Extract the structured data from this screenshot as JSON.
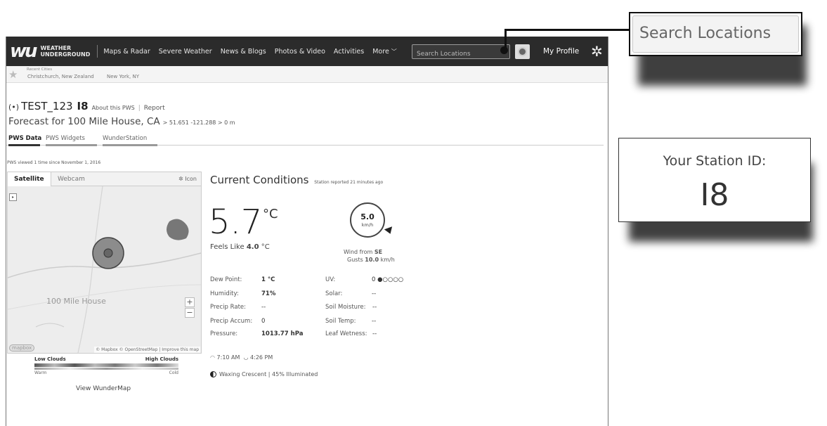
{
  "nav": {
    "logo_line1": "WEATHER",
    "logo_line2": "UNDERGROUND",
    "items": [
      "Maps & Radar",
      "Severe Weather",
      "News & Blogs",
      "Photos & Video",
      "Activities",
      "More"
    ],
    "search_placeholder": "Search Locations",
    "my_profile": "My Profile",
    "icons": [
      "wu-logo-icon",
      "chevron-down-icon",
      "locate-icon",
      "gear-icon"
    ]
  },
  "recent": {
    "label": "Recent Cities",
    "items": [
      "Christchurch, New Zealand",
      "New York, NY"
    ]
  },
  "station": {
    "name": "TEST_123",
    "id": "I8",
    "about": "About this PWS",
    "report": "Report",
    "forecast_title": "Forecast for 100 Mile House, CA",
    "forecast_coords": "> 51.651 -121.288 > 0 m"
  },
  "page_tabs": [
    "PWS Data",
    "PWS Widgets",
    "WunderStation"
  ],
  "pws_viewed": "PWS viewed 1 time since November 1, 2016",
  "map": {
    "tabs": [
      "Satellite",
      "Webcam"
    ],
    "icon_option": "Icon",
    "place_label": "100 Mile House",
    "attribution": "© Mapbox © OpenStreetMap | Improve this map",
    "mapbox": "mapbox",
    "zoom_in": "+",
    "zoom_out": "−",
    "legend_low": "Low Clouds",
    "legend_high": "High Clouds",
    "legend_warm": "Warm",
    "legend_cold": "Cold",
    "view_link": "View WunderMap"
  },
  "conditions": {
    "title": "Current Conditions",
    "reported": "Station reported 21 minutes ago",
    "temp": "5.7",
    "temp_unit": "°C",
    "feels_label": "Feels Like",
    "feels_value": "4.0",
    "feels_unit": "°C",
    "wind_speed": "5.0",
    "wind_unit": "km/h",
    "wind_from_label": "Wind from",
    "wind_from_value": "SE",
    "gusts_label": "Gusts",
    "gusts_value": "10.0",
    "gusts_unit": "km/h",
    "left_stats": [
      {
        "label": "Dew Point:",
        "value": "1 °C"
      },
      {
        "label": "Humidity:",
        "value": "71%"
      },
      {
        "label": "Precip Rate:",
        "value": "--"
      },
      {
        "label": "Precip Accum:",
        "value": "0"
      },
      {
        "label": "Pressure:",
        "value": "1013.77 hPa"
      }
    ],
    "right_stats": [
      {
        "label": "UV:",
        "value": "0 ●○○○○"
      },
      {
        "label": "Solar:",
        "value": "--"
      },
      {
        "label": "Soil Moisture:",
        "value": "--"
      },
      {
        "label": "Soil Temp:",
        "value": "--"
      },
      {
        "label": "Leaf Wetness:",
        "value": "--"
      }
    ],
    "sunrise": "7:10 AM",
    "sunset": "4:26 PM",
    "moon": "Waxing Crescent | 45% Illuminated"
  },
  "callouts": {
    "search_text": "Search Locations",
    "station_label": "Your Station ID:",
    "station_value": "I8"
  }
}
